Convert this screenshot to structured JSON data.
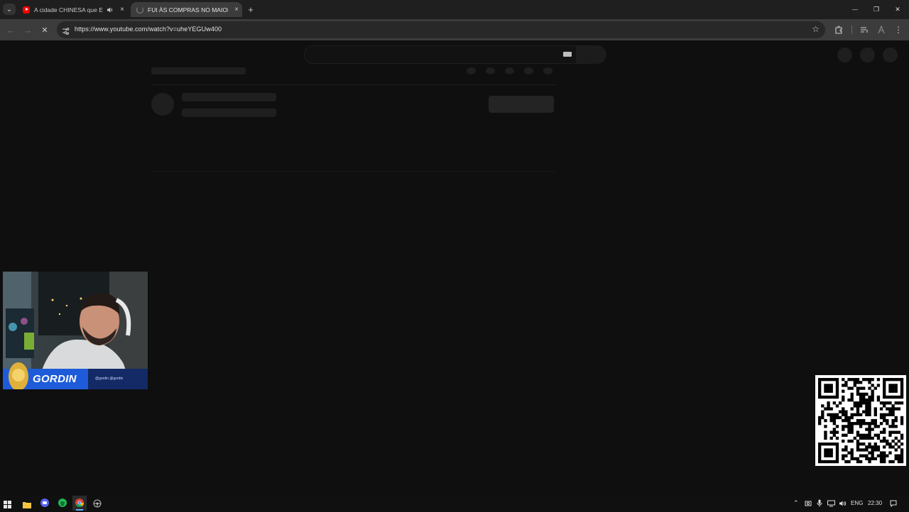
{
  "browser": {
    "tabs": [
      {
        "title": "A cidade CHINESA que ENC",
        "favicon": "youtube-icon",
        "audio_icon": "speaker-icon",
        "close": "×",
        "active": false
      },
      {
        "title": "FUI ÀS COMPRAS NO MAIOR S",
        "favicon": "loading-icon",
        "close": "×",
        "active": true
      }
    ],
    "new_tab": "+",
    "tab_search": "⌄",
    "window_controls": {
      "minimize": "—",
      "maximize": "❐",
      "close": "✕"
    },
    "url": "https://www.youtube.com/watch?v=uheYEGUw400",
    "nav": {
      "back": "←",
      "forward": "→",
      "stop": "✕"
    }
  },
  "webcam": {
    "name": "GORDIN",
    "socials": "@gordin  @gordin"
  },
  "taskbar": {
    "language": "ENG",
    "time": "22:30"
  },
  "colors": {
    "page_bg": "#0f0f0f",
    "toolbar_bg": "#3c3c3c",
    "tabstrip_bg": "#1f1f1f",
    "youtube_red": "#ff0000",
    "banner_blue": "#1e5bd8"
  }
}
